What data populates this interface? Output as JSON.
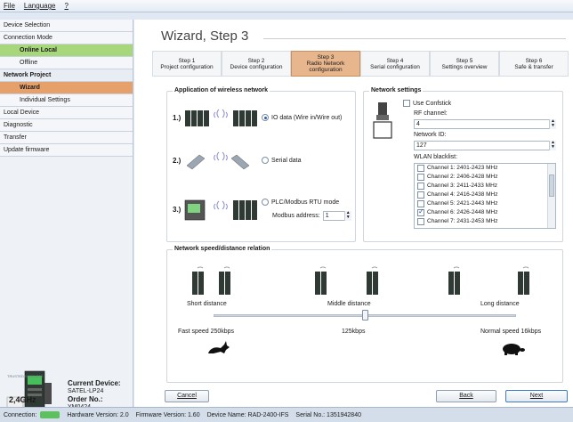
{
  "menu": {
    "items": [
      {
        "label": "File",
        "hotkey_index": 0
      },
      {
        "label": "Language",
        "hotkey_index": 0
      },
      {
        "label": "?",
        "hotkey_index": 0
      }
    ]
  },
  "sidebar": {
    "items": [
      {
        "label": "Device Selection",
        "style": "normal"
      },
      {
        "label": "Connection Mode",
        "style": "normal"
      },
      {
        "label": "Online Local",
        "style": "active-green-sub"
      },
      {
        "label": "Offline",
        "style": "sub"
      },
      {
        "label": "Network Project",
        "style": "bold"
      },
      {
        "label": "Wizard",
        "style": "active-orange-sub"
      },
      {
        "label": "Individual Settings",
        "style": "sub"
      },
      {
        "label": "Local Device",
        "style": "normal"
      },
      {
        "label": "Diagnostic",
        "style": "normal"
      },
      {
        "label": "Transfer",
        "style": "normal"
      },
      {
        "label": "Update firmware",
        "style": "normal"
      }
    ],
    "device": {
      "badge": "TRUSTED WIRELESS",
      "band": "2,4GHz",
      "current_label": "Current Device:",
      "current_value": "SATEL-LP24",
      "order_label": "Order No.:",
      "order_value": "YM0424"
    }
  },
  "wizard": {
    "title": "Wizard, Step 3",
    "steps": [
      {
        "line1": "Step 1",
        "line2": "Project configuration",
        "line3": "",
        "active": false
      },
      {
        "line1": "Step 2",
        "line2": "Device configuration",
        "line3": "",
        "active": false
      },
      {
        "line1": "Step 3",
        "line2": "Radio Network",
        "line3": "configuration",
        "active": true
      },
      {
        "line1": "Step 4",
        "line2": "Serial configuration",
        "line3": "",
        "active": false
      },
      {
        "line1": "Step 5",
        "line2": "Settings overview",
        "line3": "",
        "active": false
      },
      {
        "line1": "Step 6",
        "line2": "Safe & transfer",
        "line3": "",
        "active": false
      }
    ],
    "application": {
      "title": "Application of wireless network",
      "options": [
        {
          "num": "1.)",
          "label": "IO data (Wire in/Wire out)",
          "checked": true
        },
        {
          "num": "2.)",
          "label": "Serial data",
          "checked": false
        },
        {
          "num": "3.)",
          "label": "PLC/Modbus RTU mode",
          "checked": false
        }
      ],
      "modbus_label": "Modbus address:",
      "modbus_value": "1"
    },
    "network": {
      "title": "Network settings",
      "use_confstick_label": "Use Confstick",
      "use_confstick": false,
      "rf_channel_label": "RF channel:",
      "rf_channel_value": "4",
      "network_id_label": "Network ID:",
      "network_id_value": "127",
      "wlan_label": "WLAN blacklist:",
      "channels": [
        {
          "label": "Channel 1: 2401-2423 MHz",
          "checked": false
        },
        {
          "label": "Channel 2: 2406-2428 MHz",
          "checked": false
        },
        {
          "label": "Channel 3: 2411-2433 MHz",
          "checked": false
        },
        {
          "label": "Channel 4: 2416-2438 MHz",
          "checked": false
        },
        {
          "label": "Channel 5: 2421-2443 MHz",
          "checked": false
        },
        {
          "label": "Channel 6: 2426-2448 MHz",
          "checked": true
        },
        {
          "label": "Channel 7: 2431-2453 MHz",
          "checked": false
        }
      ]
    },
    "speed": {
      "title": "Network speed/distance relation",
      "short": "Short distance",
      "middle": "Middle distance",
      "long": "Long distance",
      "fast": "Fast speed 250kbps",
      "mid_speed": "125kbps",
      "normal": "Normal speed 16kbps",
      "slider_position": 0.5
    },
    "buttons": {
      "cancel": "Cancel",
      "back": "Back",
      "next": "Next"
    }
  },
  "status": {
    "connection_label": "Connection:",
    "hardware": "Hardware Version: 2.0",
    "firmware": "Firmware Version: 1.60",
    "device_name": "Device Name: RAD-2400-IFS",
    "serial": "Serial No.: 1351942840"
  },
  "colors": {
    "active_green": "#a8d67a",
    "active_orange": "#e6a06a",
    "step_active": "#e8b68d"
  }
}
